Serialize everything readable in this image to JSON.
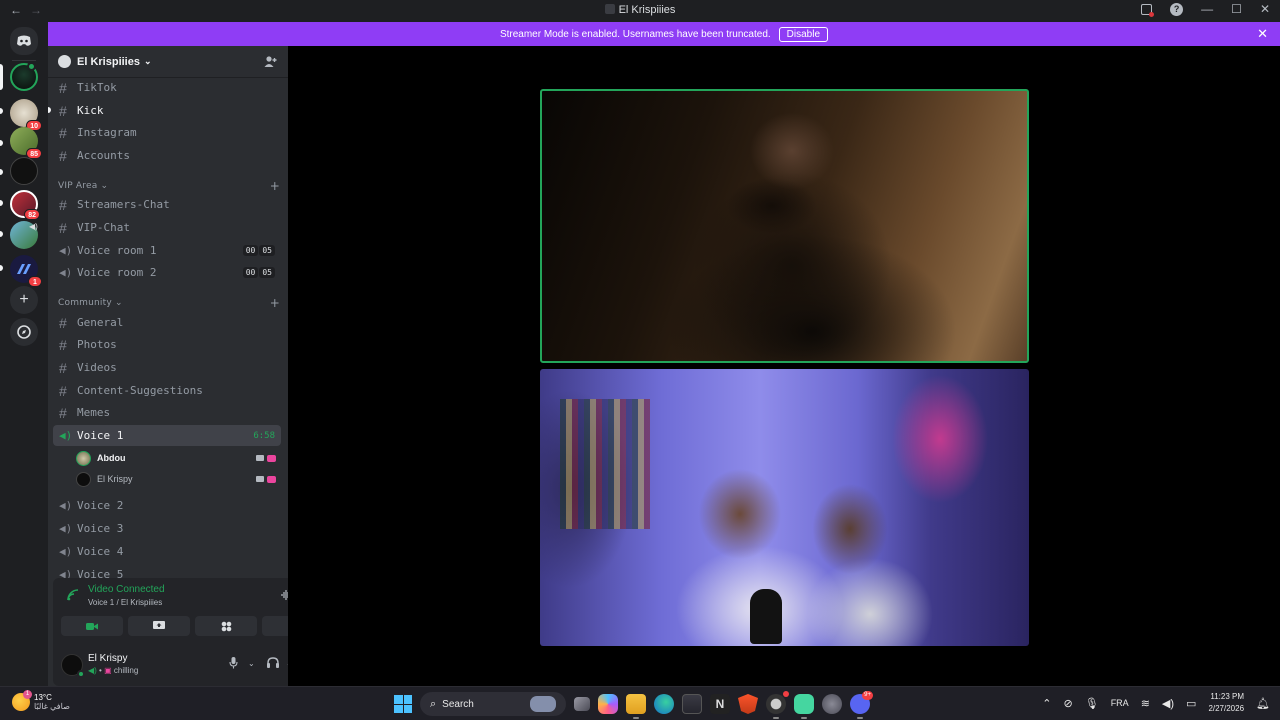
{
  "titlebar": {
    "back": "←",
    "forward": "→",
    "title": "El Krispiiies",
    "minimize": "—",
    "maximize": "☐",
    "close": "✕"
  },
  "banner": {
    "message": "Streamer Mode is enabled. Usernames have been truncated.",
    "disable_label": "Disable",
    "close": "✕"
  },
  "rail": {
    "servers": [
      {
        "name": "server-1",
        "badge": ""
      },
      {
        "name": "server-2",
        "badge": "10"
      },
      {
        "name": "server-3",
        "badge": "85"
      },
      {
        "name": "server-4",
        "badge": ""
      },
      {
        "name": "server-5",
        "badge": "82"
      },
      {
        "name": "server-6",
        "badge": ""
      },
      {
        "name": "server-7",
        "badge": "1"
      }
    ]
  },
  "server": {
    "name": "El Krispiiies",
    "chevron": "⌄"
  },
  "channels_top": [
    {
      "label": "TikTok"
    },
    {
      "label": "Kick"
    },
    {
      "label": "Instagram"
    },
    {
      "label": "Accounts"
    }
  ],
  "vip": {
    "category": "VIP Area ⌄",
    "plus": "+",
    "text_channels": [
      {
        "label": "Streamers-Chat"
      },
      {
        "label": "VIP-Chat"
      }
    ],
    "voice_channels": [
      {
        "label": "Voice room 1",
        "count_a": "00",
        "count_b": "05"
      },
      {
        "label": "Voice room 2",
        "count_a": "00",
        "count_b": "05"
      }
    ]
  },
  "community": {
    "category": "Community ⌄",
    "plus": "+",
    "text_channels": [
      {
        "label": "General"
      },
      {
        "label": "Photos"
      },
      {
        "label": "Videos"
      },
      {
        "label": "Content-Suggestions"
      },
      {
        "label": "Memes"
      }
    ],
    "active_voice": {
      "label": "Voice 1",
      "time": "6:58"
    },
    "voice_users": [
      {
        "name": "Abdou"
      },
      {
        "name": "El Krispy"
      }
    ],
    "voice_channels": [
      {
        "label": "Voice 2"
      },
      {
        "label": "Voice 3"
      },
      {
        "label": "Voice 4"
      },
      {
        "label": "Voice 5"
      }
    ]
  },
  "voice_panel": {
    "status": "Video Connected",
    "location": "Voice 1 / El Krispiiies"
  },
  "user_panel": {
    "name": "El Krispy",
    "status": "chilling"
  },
  "taskbar": {
    "temperature": "13°C",
    "weather_text": "صافي غالبًا",
    "search_label": "Search",
    "discord_badge": "9+",
    "language": "FRA",
    "time": "11:23 PM",
    "date": "2/27/2026"
  },
  "colors": {
    "accent_banner": "#8f3df5",
    "speaking_green": "#23a55a",
    "badge_red": "#f23f43"
  }
}
